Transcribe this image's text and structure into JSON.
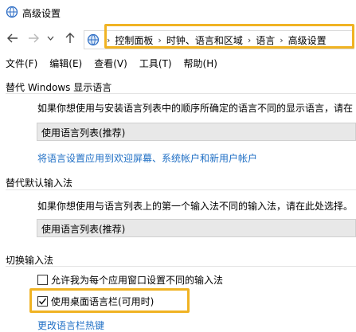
{
  "window": {
    "title": "高级设置"
  },
  "address": {
    "crumbs": [
      "控制面板",
      "时钟、语言和区域",
      "语言",
      "高级设置"
    ]
  },
  "menu": {
    "items": [
      "文件(F)",
      "编辑(E)",
      "查看(V)",
      "工具(T)",
      "帮助(H)"
    ]
  },
  "display_language": {
    "title": "替代 Windows 显示语言",
    "description": "如果你想使用与安装语言列表中的顺序所确定的语言不同的显示语言，请在",
    "selected": "使用语言列表(推荐)",
    "link": "将语言设置应用到欢迎屏幕、系统帐户和新用户帐户"
  },
  "input_method": {
    "title": "替代默认输入法",
    "description": "如果你想使用与语言列表上的第一个输入法不同的输入法，请在此处选择。",
    "selected": "使用语言列表(推荐)"
  },
  "switch_input": {
    "title": "切换输入法",
    "option1": {
      "label": "允许我为每个应用窗口设置不同的输入法",
      "checked": false
    },
    "option2": {
      "label": "使用桌面语言栏(可用时)",
      "checked": true
    },
    "link": "更改语言栏热键"
  },
  "colors": {
    "highlight": "#f0b323",
    "link": "#1f6fc5"
  }
}
